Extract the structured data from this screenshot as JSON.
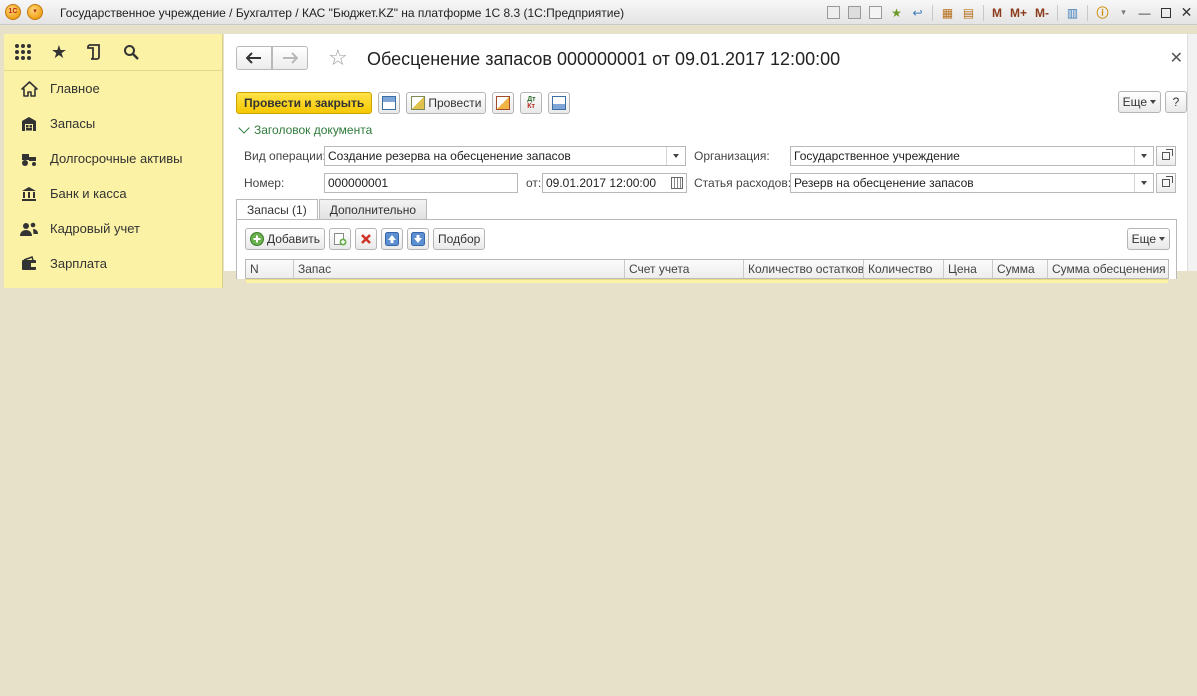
{
  "window": {
    "title": "Государственное учреждение / Бухгалтер / КАС \"Бюджет.KZ\" на платформе 1С 8.3  (1С:Предприятие)",
    "logo_text": "1C",
    "toolbar_icons": [
      "save-icon",
      "print-icon",
      "preview-icon",
      "add-favorites-icon",
      "calendar-icon",
      "calculator-icon"
    ],
    "memory_buttons": [
      "M",
      "M+",
      "M-"
    ],
    "window_controls": [
      "info-icon",
      "minimize-icon",
      "maximize-icon",
      "close-icon"
    ]
  },
  "left_panel": {
    "tools": [
      "apps-icon",
      "star-icon",
      "history-icon",
      "search-icon"
    ],
    "items": [
      {
        "label": "Главное",
        "icon": "home-icon"
      },
      {
        "label": "Запасы",
        "icon": "warehouse-icon"
      },
      {
        "label": "Долгосрочные активы",
        "icon": "tractor-icon"
      },
      {
        "label": "Банк и касса",
        "icon": "bank-icon"
      },
      {
        "label": "Кадровый учет",
        "icon": "people-icon"
      },
      {
        "label": "Зарплата",
        "icon": "wallet-icon"
      }
    ]
  },
  "form": {
    "title": "Обесценение запасов 000000001 от 09.01.2017 12:00:00",
    "commands": {
      "post_and_close": "Провести и закрыть",
      "post": "Провести",
      "more": "Еще",
      "help": "?"
    },
    "section": "Заголовок документа",
    "fields": {
      "operation_label": "Вид операции:",
      "operation_value": "Создание резерва на обесценение запасов",
      "org_label": "Организация:",
      "org_value": "Государственное учреждение",
      "number_label": "Номер:",
      "number_value": "000000001",
      "date_label": "от:",
      "date_value": "09.01.2017 12:00:00",
      "expense_label": "Статья расходов:",
      "expense_value": "Резерв на обесценение запасов"
    },
    "tabs": [
      "Запасы (1)",
      "Дополнительно"
    ],
    "table_commands": {
      "add": "Добавить",
      "pick": "Подбор",
      "more": "Еще"
    },
    "table_columns": [
      "N",
      "Запас",
      "Счет учета",
      "Количество остатков",
      "Количество",
      "Цена",
      "Сумма",
      "Сумма обесценения"
    ]
  }
}
